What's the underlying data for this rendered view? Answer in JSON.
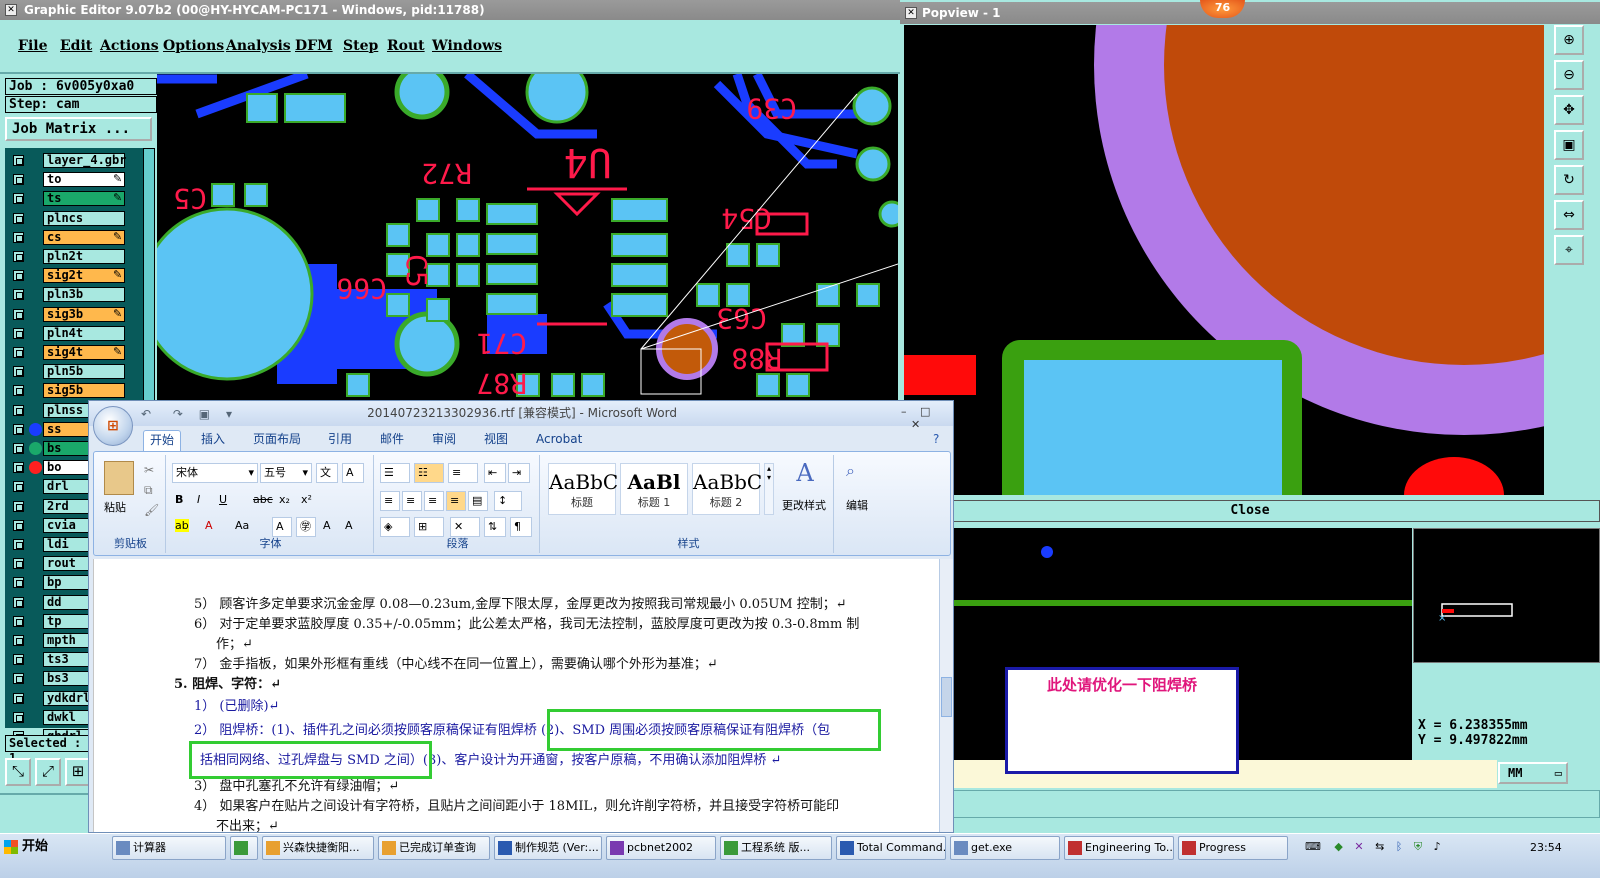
{
  "ge": {
    "title": "Graphic Editor 9.07b2 (00@HY-HYCAM-PC171 - Windows, pid:11788)",
    "menu": [
      "File",
      "Edit",
      "Actions",
      "Options",
      "Analysis",
      "DFM",
      "Step",
      "Rout",
      "Windows"
    ],
    "job": "Job : 6v005y0xa0",
    "step": "Step: cam",
    "job_matrix": "Job Matrix ...",
    "layers": [
      {
        "name": "layer_4.gbr",
        "color": "#a8e8e0"
      },
      {
        "name": "to",
        "color": "#ffffff",
        "mark": "✎"
      },
      {
        "name": "ts",
        "color": "#1aa86a",
        "mark": "✎"
      },
      {
        "name": "plncs",
        "color": "#a8e8e0"
      },
      {
        "name": "cs",
        "color": "#ffb84c",
        "mark": "✎"
      },
      {
        "name": "pln2t",
        "color": "#a8e8e0"
      },
      {
        "name": "sig2t",
        "color": "#ffb84c",
        "mark": "✎"
      },
      {
        "name": "pln3b",
        "color": "#a8e8e0"
      },
      {
        "name": "sig3b",
        "color": "#ffb84c",
        "mark": "✎"
      },
      {
        "name": "pln4t",
        "color": "#a8e8e0"
      },
      {
        "name": "sig4t",
        "color": "#ffb84c",
        "mark": "✎"
      },
      {
        "name": "pln5b",
        "color": "#a8e8e0"
      },
      {
        "name": "sig5b",
        "color": "#ffb84c"
      },
      {
        "name": "plnss",
        "color": "#a8e8e0"
      },
      {
        "name": "ss",
        "color": "#ffb84c",
        "dot": "#1a3cff"
      },
      {
        "name": "bs",
        "color": "#1aa86a",
        "dot": "#1aa86a"
      },
      {
        "name": "bo",
        "color": "#ffffff",
        "dot": "#ff2020"
      },
      {
        "name": "drl",
        "color": "#a8e8e0"
      },
      {
        "name": "2rd",
        "color": "#a8e8e0"
      },
      {
        "name": "cvia",
        "color": "#a8e8e0"
      },
      {
        "name": "ldi",
        "color": "#a8e8e0"
      },
      {
        "name": "rout",
        "color": "#a8e8e0"
      },
      {
        "name": "bp",
        "color": "#a8e8e0"
      },
      {
        "name": "dd",
        "color": "#a8e8e0"
      },
      {
        "name": "tp",
        "color": "#a8e8e0"
      },
      {
        "name": "mpth",
        "color": "#a8e8e0"
      },
      {
        "name": "ts3",
        "color": "#a8e8e0"
      },
      {
        "name": "bs3",
        "color": "#a8e8e0"
      },
      {
        "name": "ydkdrl",
        "color": "#a8e8e0"
      },
      {
        "name": "dwkl",
        "color": "#a8e8e0"
      },
      {
        "name": "gbdrl",
        "color": "#a8e8e0"
      }
    ],
    "selected": "Selected : 1",
    "designators": [
      "C39",
      "U4",
      "R72",
      "C54",
      "C5",
      "C66",
      "C71",
      "R88",
      "R87",
      "C63",
      "C5"
    ]
  },
  "pv": {
    "title": "Popview - 1",
    "close": "Close",
    "annotation": "此处请优化一下阻焊桥",
    "x": "X =  6.238355mm",
    "y": "Y =  9.497822mm",
    "units": "MM",
    "badge": "76"
  },
  "word": {
    "title": "20140723213302936.rtf [兼容模式] - Microsoft Word",
    "tabs": [
      "开始",
      "插入",
      "页面布局",
      "引用",
      "邮件",
      "审阅",
      "视图",
      "Acrobat"
    ],
    "font_name": "宋体",
    "font_size": "五号",
    "groups": {
      "clipboard": "剪贴板",
      "font": "字体",
      "paragraph": "段落",
      "styles": "样式",
      "edit": "编辑"
    },
    "paste": "粘贴",
    "styles": [
      {
        "sample": "AaBbC",
        "name": "标题"
      },
      {
        "sample": "AaBl",
        "name": "标题 1"
      },
      {
        "sample": "AaBbC",
        "name": "标题 2"
      }
    ],
    "change_styles": "更改样式",
    "edit_btn": "编辑",
    "lines": [
      "5） 顾客许多定单要求沉金金厚 0.08—0.23um,金厚下限太厚，金厚更改为按照我司常规最小 0.05UM 控制；↵",
      "6） 对于定单要求蓝胶厚度 0.35+/-0.05mm；此公差太严格，我司无法控制，蓝胶厚度可更改为按 0.3-0.8mm 制",
      "作；↵",
      "7） 金手指板，如果外形框有重线（中心线不在同一位置上），需要确认哪个外形为基准；↵",
      "5.   阻焊、字符：↵",
      "1） (已删除)↵",
      "2） 阻焊桥：(1)、插件孔之间必须按顾客原稿保证有阻焊桥 (2)、SMD 周围必须按顾客原稿保证有阻焊桥（包",
      "括相同网络、过孔焊盘与 SMD 之间）(3)、客户设计为开通窗，按客户原稿，不用确认添加阻焊桥    ↵",
      "3） 盘中孔塞孔不允许有绿油帽；↵",
      "4） 如果客户在贴片之间设计有字符桥，且贴片之间间距小于 18MIL，则允许削字符桥，并且接受字符桥可能印",
      "不出来；↵"
    ]
  },
  "taskbar": {
    "start": "开始",
    "tasks": [
      {
        "label": "计算器",
        "icon": "#6a8bc0"
      },
      {
        "label": "",
        "icon": "#3a9a3a"
      },
      {
        "label": "兴森快捷衡阳...",
        "icon": "#e8a030"
      },
      {
        "label": "已完成订单查询",
        "icon": "#e8a030"
      },
      {
        "label": "制作规范 (Ver:...",
        "icon": "#2a5ab0"
      },
      {
        "label": "pcbnet2002",
        "icon": "#7a3ab0"
      },
      {
        "label": "工程系统  版...",
        "icon": "#3a9a3a"
      },
      {
        "label": "Total Command...",
        "icon": "#2a5ab0"
      },
      {
        "label": "get.exe",
        "icon": "#6a8bc0"
      },
      {
        "label": "Engineering To...",
        "icon": "#c03030"
      },
      {
        "label": "Progress",
        "icon": "#c03030"
      }
    ],
    "clock": "23:54"
  }
}
